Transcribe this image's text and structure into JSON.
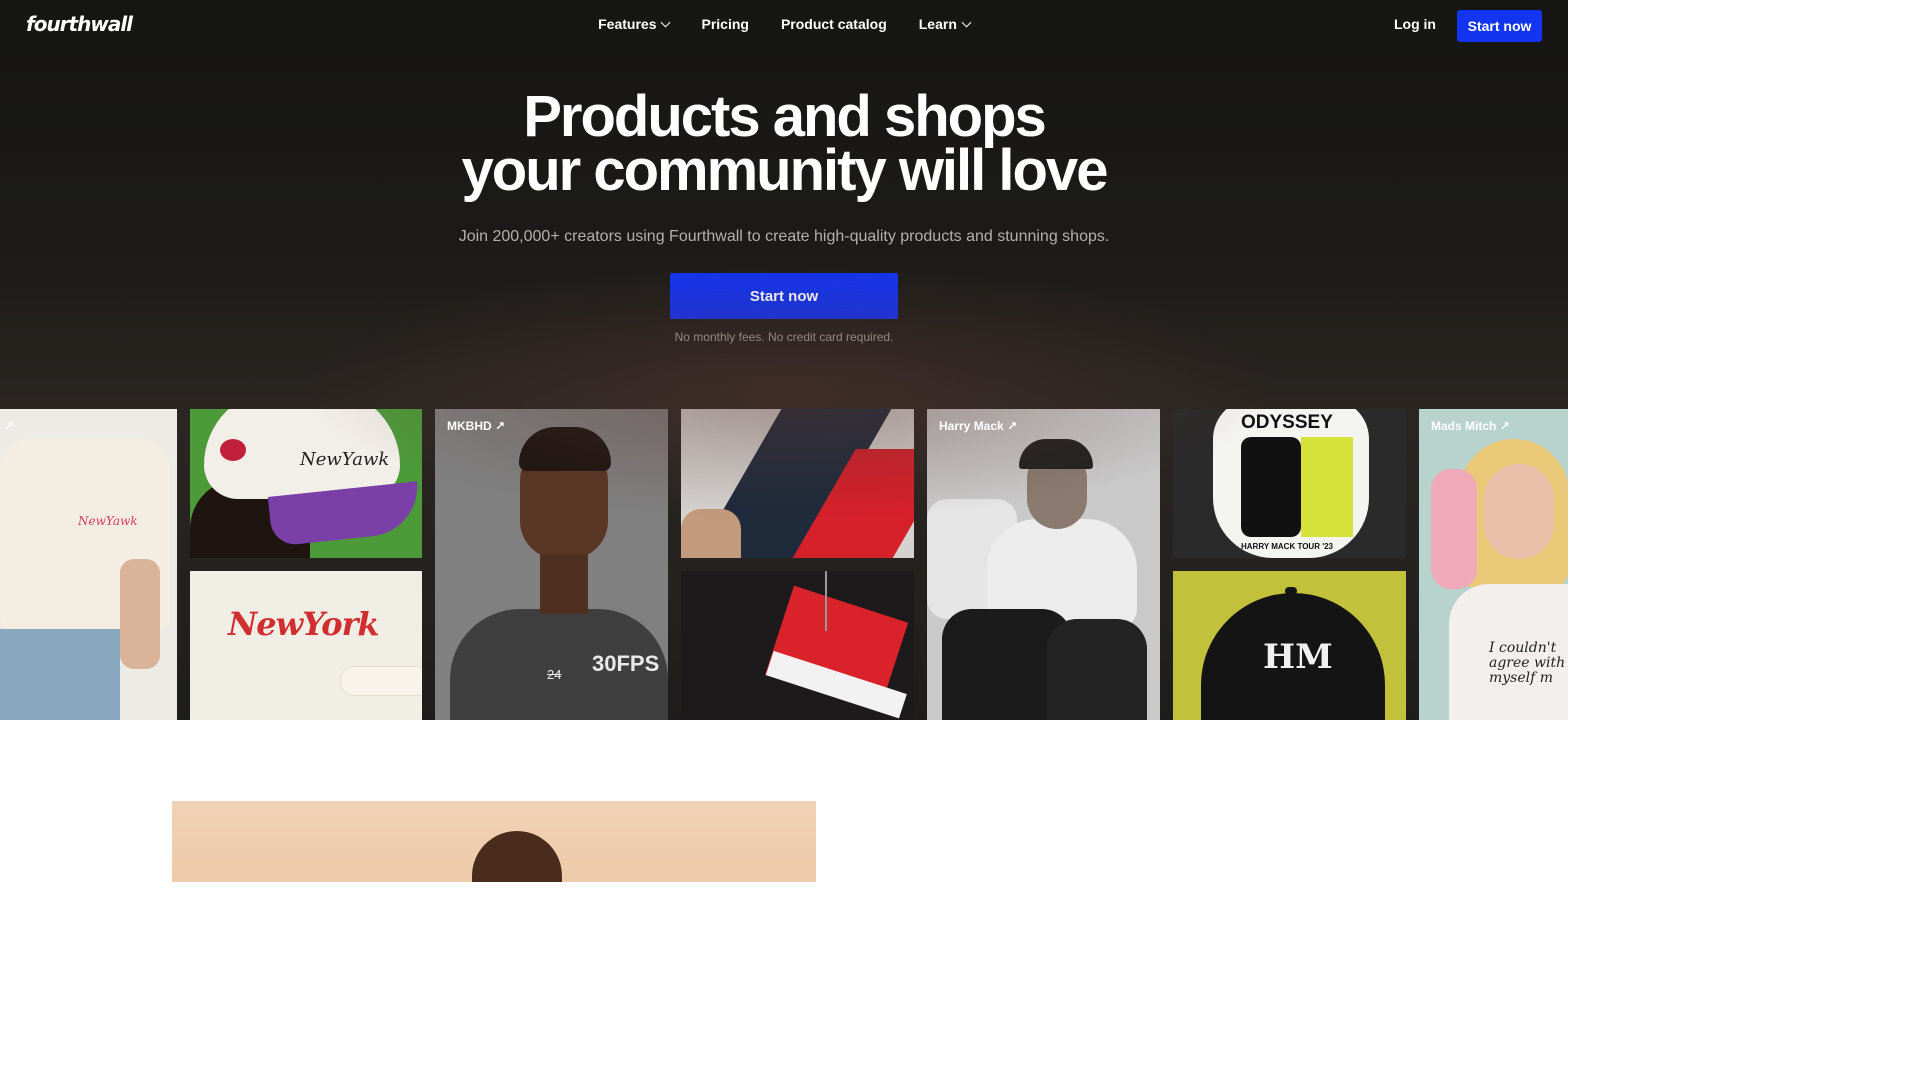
{
  "nav": {
    "logo": "fourthwall",
    "links": [
      {
        "label": "Features",
        "dropdown": true
      },
      {
        "label": "Pricing",
        "dropdown": false
      },
      {
        "label": "Product catalog",
        "dropdown": false
      },
      {
        "label": "Learn",
        "dropdown": true
      }
    ],
    "login": "Log in",
    "cta": "Start now"
  },
  "hero": {
    "headline_line1": "Products and shops",
    "headline_line2": "your community will love",
    "subheadline": "Join 200,000+ creators using Fourthwall to create high-quality products and stunning shops.",
    "cta": "Start now",
    "note": "No monthly fees. No credit card required."
  },
  "gallery": {
    "creators": [
      {
        "name": "",
        "link_icon": "arrow-up-right-icon"
      },
      {
        "name": "MKBHD",
        "link_icon": "arrow-up-right-icon"
      },
      {
        "name": "Harry Mack",
        "link_icon": "arrow-up-right-icon"
      },
      {
        "name": "Mads Mitch",
        "link_icon": "arrow-up-right-icon"
      }
    ],
    "product_text": {
      "cap_text": "NewYawk",
      "sweater_text": "NewYork",
      "tee_text_strike": "24",
      "tee_text": "30FPS",
      "hoodie_title": "ODYSSEY",
      "hoodie_caption": "HARRY MACK TOUR '23",
      "hat_text": "HM",
      "shirt_text": "I couldn't agree with myself m"
    }
  },
  "colors": {
    "accent": "#1334f0",
    "hero_bg": "#1c1b18"
  }
}
